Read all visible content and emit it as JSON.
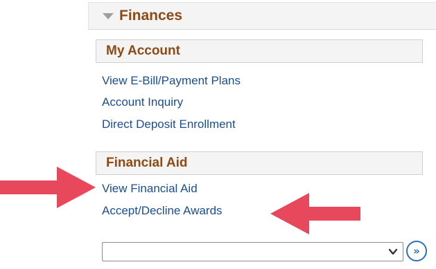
{
  "finances": {
    "title": "Finances"
  },
  "my_account": {
    "title": "My Account",
    "links": [
      "View E-Bill/Payment Plans",
      "Account Inquiry",
      "Direct Deposit Enrollment"
    ]
  },
  "financial_aid": {
    "title": "Financial Aid",
    "links": [
      "View Financial Aid",
      "Accept/Decline Awards"
    ]
  },
  "nav": {
    "select_value": "",
    "go_glyph": "»"
  },
  "colors": {
    "header_text": "#8e4a14",
    "link": "#1c4e8c",
    "arrow": "#e8485c",
    "go_button": "#2b6fb7"
  }
}
